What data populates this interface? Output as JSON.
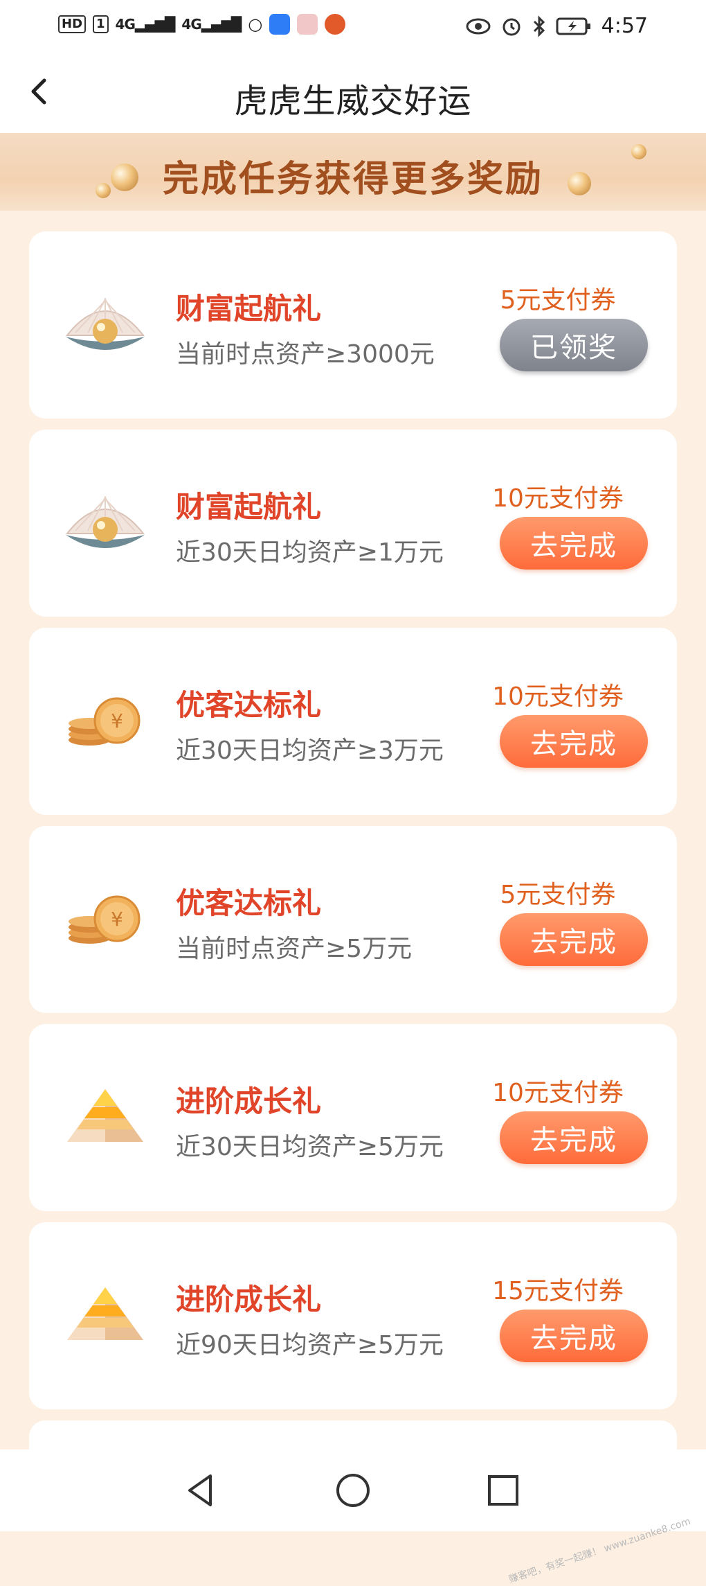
{
  "statusbar": {
    "left_badges": [
      "HD",
      "1"
    ],
    "signal1": "4G",
    "signal2": "4G",
    "time": "4:57",
    "icons": [
      "eye-icon",
      "alarm-icon",
      "bluetooth-icon",
      "battery-charging-icon"
    ]
  },
  "header": {
    "title": "虎虎生威交好运",
    "back_icon": "chevron-left-icon"
  },
  "banner": {
    "text": "完成任务获得更多奖励"
  },
  "tasks": [
    {
      "icon": "pearl-shell-icon",
      "title": "财富起航礼",
      "desc": "当前时点资产≥3000元",
      "reward": "5元支付券",
      "button": "已领奖",
      "status": "claimed"
    },
    {
      "icon": "pearl-shell-icon",
      "title": "财富起航礼",
      "desc": "近30天日均资产≥1万元",
      "reward": "10元支付券",
      "button": "去完成",
      "status": "todo"
    },
    {
      "icon": "coin-stack-icon",
      "title": "优客达标礼",
      "desc": "近30天日均资产≥3万元",
      "reward": "10元支付券",
      "button": "去完成",
      "status": "todo"
    },
    {
      "icon": "coin-stack-icon",
      "title": "优客达标礼",
      "desc": "当前时点资产≥5万元",
      "reward": "5元支付券",
      "button": "去完成",
      "status": "todo"
    },
    {
      "icon": "pyramid-icon",
      "title": "进阶成长礼",
      "desc": "近30天日均资产≥5万元",
      "reward": "10元支付券",
      "button": "去完成",
      "status": "todo"
    },
    {
      "icon": "pyramid-icon",
      "title": "进阶成长礼",
      "desc": "近90天日均资产≥5万元",
      "reward": "15元支付券",
      "button": "去完成",
      "status": "todo"
    }
  ],
  "navbar": {
    "icons": [
      "nav-back-icon",
      "nav-home-icon",
      "nav-recents-icon"
    ]
  },
  "watermark": "赚客吧，有奖一起赚！ www.zuanke8.com",
  "colors": {
    "accent_orange": "#ff6b3a",
    "title_red": "#e0452a",
    "reward_orange": "#e0601f",
    "claimed_gray": "#8a8d95",
    "page_bg": "#fdf0e2"
  }
}
